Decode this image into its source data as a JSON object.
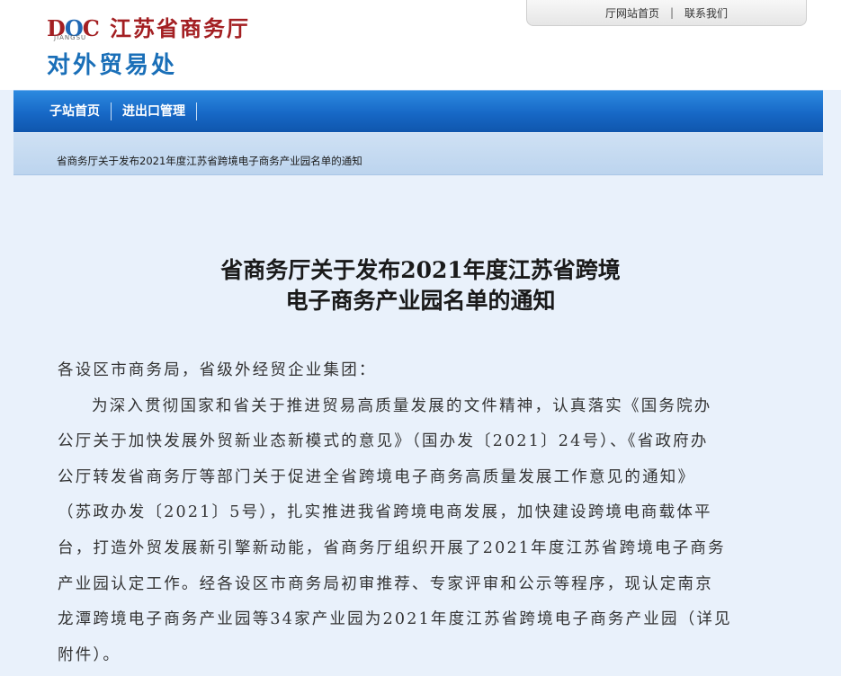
{
  "header": {
    "logo_text_d": "D",
    "logo_text_o": "O",
    "logo_text_c": "C",
    "logo_sub": "JIANGSU",
    "site_name": "江苏省商务厅",
    "dept_name": "对外贸易处",
    "top_links": [
      "厅网站首页",
      "联系我们"
    ],
    "top_links_sep": "|"
  },
  "nav": {
    "items": [
      "子站首页",
      "进出口管理"
    ]
  },
  "breadcrumb": "省商务厅关于发布2021年度江苏省跨境电子商务产业园名单的通知",
  "article": {
    "title_lines": [
      "省商务厅关于发布2021年度江苏省跨境",
      "电子商务产业园名单的通知"
    ],
    "salutation": "各设区市商务局，省级外经贸企业集团：",
    "body_lines": [
      "为深入贯彻国家和省关于推进贸易高质量发展的文件精神，认真落实《国务院办",
      "公厅关于加快发展外贸新业态新模式的意见》（国办发〔2021〕24号）、《省政府办",
      "公厅转发省商务厅等部门关于促进全省跨境电子商务高质量发展工作意见的通知》",
      "（苏政办发〔2021〕5号），扎实推进我省跨境电商发展，加快建设跨境电商载体平",
      "台，打造外贸发展新引擎新动能，省商务厅组织开展了2021年度江苏省跨境电子商务",
      "产业园认定工作。经各设区市商务局初审推荐、专家评审和公示等程序，现认定南京",
      "龙潭跨境电子商务产业园等34家产业园为2021年度江苏省跨境电子商务产业园（详见",
      "附件）。"
    ]
  },
  "colors": {
    "brand_red": "#a31f22",
    "brand_blue": "#1a6fb8",
    "nav_blue": "#1768c6",
    "page_bg": "#e9f1fb"
  }
}
